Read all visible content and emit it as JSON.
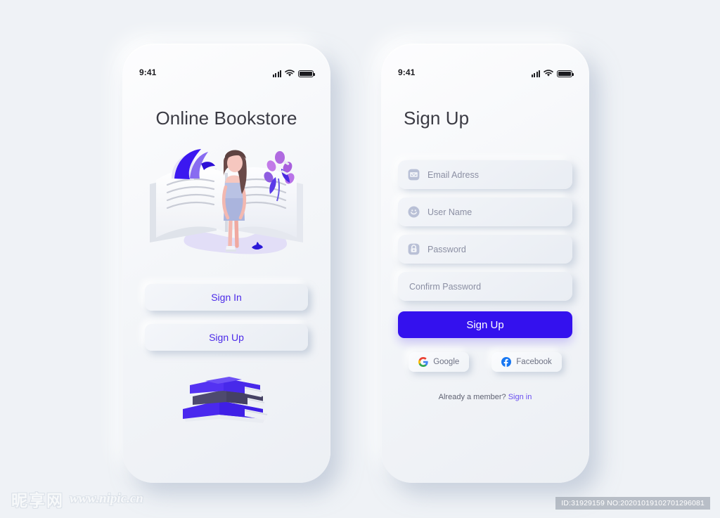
{
  "theme": {
    "background": "#eff2f6",
    "accent": "#3411ee",
    "accent_text": "#4b29e8",
    "link": "#6a4ef0",
    "placeholder": "#8b8fa3",
    "title_color": "#3b3b44"
  },
  "screens": [
    {
      "id": "welcome",
      "status_bar": {
        "time": "9:41",
        "signal_icon": "signal-bars-icon",
        "wifi_icon": "wifi-icon",
        "battery_icon": "battery-full-icon"
      },
      "title": "Online Bookstore",
      "illustration_top": "woman-reading-open-book-illustration",
      "illustration_bottom": "stacked-books-illustration",
      "buttons": [
        {
          "label": "Sign In",
          "name": "sign-in-button"
        },
        {
          "label": "Sign Up",
          "name": "sign-up-button"
        }
      ]
    },
    {
      "id": "signup",
      "status_bar": {
        "time": "9:41",
        "signal_icon": "signal-bars-icon",
        "wifi_icon": "wifi-icon",
        "battery_icon": "battery-full-icon"
      },
      "title": "Sign Up",
      "fields": [
        {
          "placeholder": "Email Adress",
          "icon": "envelope-icon",
          "name": "email-field",
          "value": ""
        },
        {
          "placeholder": "User Name",
          "icon": "user-icon",
          "name": "username-field",
          "value": ""
        },
        {
          "placeholder": "Password",
          "icon": "lock-icon",
          "name": "password-field",
          "value": ""
        },
        {
          "placeholder": "Confirm Password",
          "icon": "none",
          "name": "confirm-password-field",
          "value": ""
        }
      ],
      "cta": {
        "label": "Sign Up",
        "name": "submit-sign-up-button"
      },
      "socials": [
        {
          "label": "Google",
          "icon": "google-icon",
          "name": "google-sign-up-button"
        },
        {
          "label": "Facebook",
          "icon": "facebook-icon",
          "name": "facebook-sign-up-button"
        }
      ],
      "footer": {
        "prompt": "Already a member?",
        "link": "Sign in"
      }
    }
  ],
  "watermark": {
    "brand_cn": "昵享网",
    "brand_url": "www.nipic.cn",
    "id_text": "ID:31929159 NO:20201019102701296081"
  }
}
